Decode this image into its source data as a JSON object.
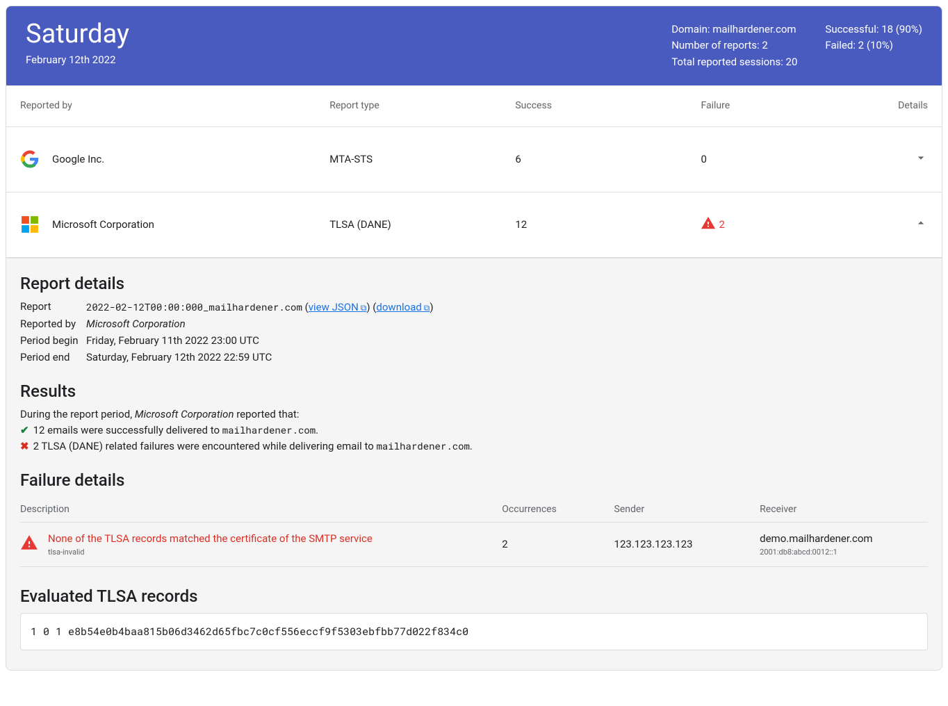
{
  "header": {
    "day_name": "Saturday",
    "date": "February 12th 2022",
    "domain_line": "Domain: mailhardener.com",
    "num_reports_line": "Number of reports: 2",
    "sessions_line": "Total reported sessions: 20",
    "successful_line": "Successful: 18 (90%)",
    "failed_line": "Failed: 2 (10%)"
  },
  "columns": {
    "reported_by": "Reported by",
    "report_type": "Report type",
    "success": "Success",
    "failure": "Failure",
    "details": "Details"
  },
  "rows": {
    "google": {
      "name": "Google Inc.",
      "type": "MTA-STS",
      "success": "6",
      "failure": "0"
    },
    "microsoft": {
      "name": "Microsoft Corporation",
      "type": "TLSA (DANE)",
      "success": "12",
      "failure": "2"
    }
  },
  "details": {
    "title": "Report details",
    "labels": {
      "report": "Report",
      "reported_by": "Reported by",
      "period_begin": "Period begin",
      "period_end": "Period end"
    },
    "report_id": "2022-02-12T00:00:000_mailhardener.com",
    "view_json": "view JSON",
    "download": "download",
    "reported_by_value": "Microsoft Corporation",
    "period_begin_value": "Friday, February 11th 2022 23:00 UTC",
    "period_end_value": "Saturday, February 12th 2022 22:59 UTC"
  },
  "results": {
    "title": "Results",
    "intro_prefix": "During the report period, ",
    "intro_reporter": "Microsoft Corporation",
    "intro_suffix": " reported that:",
    "success_prefix": "12 emails were successfully delivered to ",
    "success_domain": "mailhardener.com",
    "fail_prefix": "2 TLSA (DANE) related failures were encountered while delivering email to ",
    "fail_domain": "mailhardener.com"
  },
  "failure": {
    "title": "Failure details",
    "cols": {
      "description": "Description",
      "occurrences": "Occurrences",
      "sender": "Sender",
      "receiver": "Receiver"
    },
    "row": {
      "desc": "None of the TLSA records matched the certificate of the SMTP service",
      "sub": "tlsa-invalid",
      "occurrences": "2",
      "sender": "123.123.123.123",
      "receiver": "demo.mailhardener.com",
      "receiver_sub": "2001:db8:abcd:0012::1"
    }
  },
  "tlsa": {
    "title": "Evaluated TLSA records",
    "record": "1 0 1 e8b54e0b4baa815b06d3462d65fbc7c0cf556eccf9f5303ebfbb77d022f834c0"
  }
}
